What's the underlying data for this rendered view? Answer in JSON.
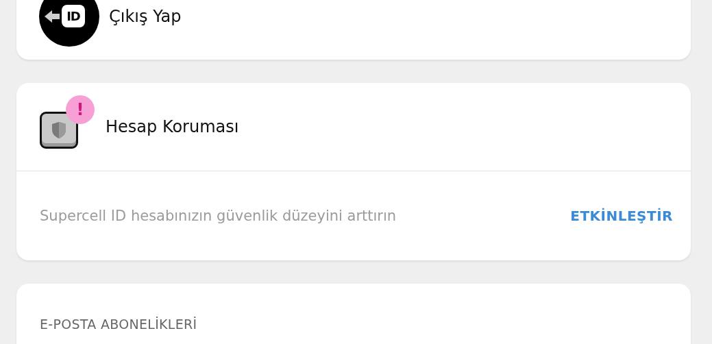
{
  "logout": {
    "label": "Çıkış Yap",
    "icon_text": "ID"
  },
  "protection": {
    "title": "Hesap Koruması",
    "alert": "!",
    "description": "Supercell ID hesabınızın güvenlik düzeyini arttırın",
    "action": "ETKİNLEŞTİR"
  },
  "email_subscriptions": {
    "heading": "E-POSTA ABONELİKLERİ"
  }
}
